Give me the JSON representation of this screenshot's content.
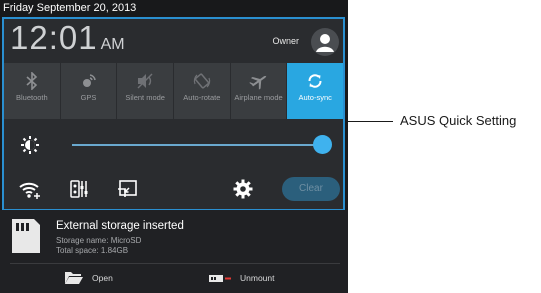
{
  "status_bar": {
    "date": "Friday September 20, 2013"
  },
  "clock": {
    "time": "12:01",
    "ampm": "AM"
  },
  "user": {
    "name": "Owner",
    "icon": "person-icon"
  },
  "quick_settings": {
    "tiles": [
      {
        "label": "Bluetooth",
        "icon": "bluetooth-icon",
        "active": false
      },
      {
        "label": "GPS",
        "icon": "gps-icon",
        "active": false
      },
      {
        "label": "Silent mode",
        "icon": "silent-mode-icon",
        "active": false
      },
      {
        "label": "Auto-rotate",
        "icon": "auto-rotate-icon",
        "active": false
      },
      {
        "label": "Airplane mode",
        "icon": "airplane-icon",
        "active": false
      },
      {
        "label": "Auto-sync",
        "icon": "sync-icon",
        "active": true
      }
    ],
    "brightness": {
      "icon": "brightness-icon",
      "level": 0.95
    },
    "bottom_icons": [
      "wifi-settings-icon",
      "equalizer-icon",
      "screen-cast-icon",
      "settings-gear-icon"
    ],
    "clear_label": "Clear"
  },
  "notification": {
    "title": "External storage inserted",
    "storage_name": "Storage name: MicroSD",
    "total_space": "Total space: 1.84GB",
    "actions": [
      {
        "label": "Open",
        "icon": "folder-icon"
      },
      {
        "label": "Unmount",
        "icon": "unmount-icon"
      }
    ]
  },
  "callout": {
    "label": "ASUS Quick Setting"
  },
  "colors": {
    "accent": "#29a7e1",
    "frame": "#2a8fd0",
    "panel": "#18191b"
  }
}
